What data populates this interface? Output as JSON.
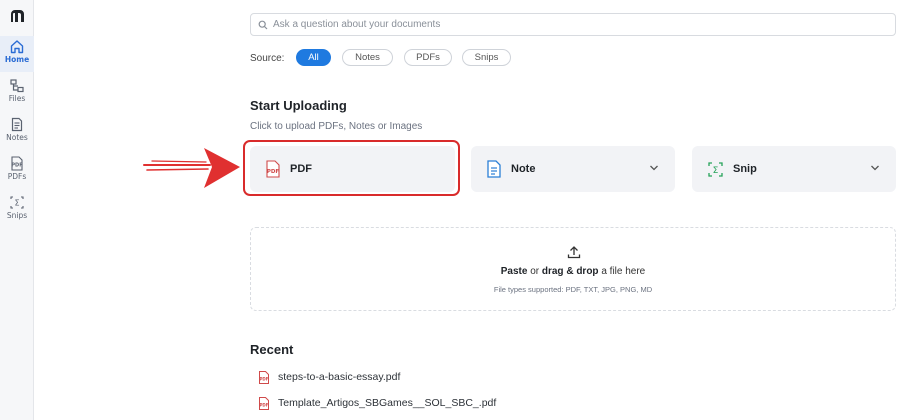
{
  "sidebar": {
    "items": [
      {
        "label": "Home",
        "icon": "home-icon",
        "active": true
      },
      {
        "label": "Files",
        "icon": "files-icon",
        "active": false
      },
      {
        "label": "Notes",
        "icon": "notes-icon",
        "active": false
      },
      {
        "label": "PDFs",
        "icon": "pdf-icon",
        "active": false
      },
      {
        "label": "Snips",
        "icon": "snip-icon",
        "active": false
      }
    ]
  },
  "search": {
    "placeholder": "Ask a question about your documents",
    "value": ""
  },
  "source": {
    "label": "Source:",
    "filters": [
      {
        "label": "All",
        "active": true
      },
      {
        "label": "Notes",
        "active": false
      },
      {
        "label": "PDFs",
        "active": false
      },
      {
        "label": "Snips",
        "active": false
      }
    ]
  },
  "upload": {
    "title": "Start Uploading",
    "subtitle": "Click to upload PDFs, Notes or Images",
    "cards": [
      {
        "label": "PDF",
        "icon": "pdf-file-icon"
      },
      {
        "label": "Note",
        "icon": "note-icon",
        "has_dropdown": true
      },
      {
        "label": "Snip",
        "icon": "snip-icon",
        "has_dropdown": true
      }
    ]
  },
  "dropzone": {
    "paste": "Paste",
    "or": " or ",
    "drag": "drag & drop",
    "rest": " a file here",
    "types": "File types supported: PDF, TXT, JPG, PNG, MD"
  },
  "recent": {
    "title": "Recent",
    "items": [
      {
        "name": "steps-to-a-basic-essay.pdf"
      },
      {
        "name": "Template_Artigos_SBGames__SOL_SBC_.pdf"
      }
    ]
  },
  "colors": {
    "accent": "#1f7ae0",
    "highlight": "#d92b2b",
    "sidebar_bg": "#f6f7f9",
    "card_bg": "#f2f3f6"
  }
}
